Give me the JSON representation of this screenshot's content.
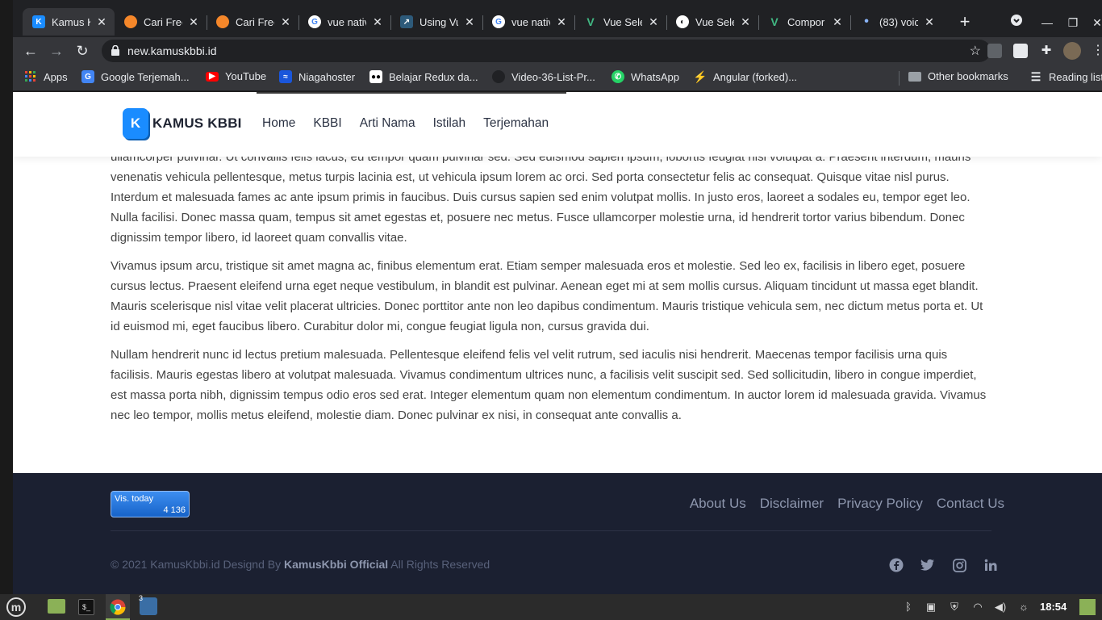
{
  "browser": {
    "tabs": [
      {
        "title": "Kamus K",
        "icon": "kamus-kbbi-favicon",
        "color": "#1a8cff",
        "glyph": "K"
      },
      {
        "title": "Cari Free",
        "icon": "orange-favicon",
        "color": "#f5872a",
        "glyph": ""
      },
      {
        "title": "Cari Free",
        "icon": "orange-favicon",
        "color": "#f5872a",
        "glyph": ""
      },
      {
        "title": "vue nativ",
        "icon": "google-icon",
        "color": "#ffffff",
        "glyph": "G"
      },
      {
        "title": "Using Vu",
        "icon": "chart-favicon",
        "color": "#2d5a7a",
        "glyph": ""
      },
      {
        "title": "vue nativ",
        "icon": "google-icon",
        "color": "#ffffff",
        "glyph": "G"
      },
      {
        "title": "Vue Sele",
        "icon": "vue-icon",
        "color": "#41b883",
        "glyph": "V"
      },
      {
        "title": "Vue Sele",
        "icon": "globe-icon",
        "color": "#ffffff",
        "glyph": ""
      },
      {
        "title": "Compor",
        "icon": "vue-icon",
        "color": "#41b883",
        "glyph": "V"
      },
      {
        "title": "(83) voic",
        "icon": "dot-favicon",
        "color": "#8ab4f8",
        "glyph": "•"
      }
    ],
    "url": "new.kamuskbbi.id",
    "bookmarks": {
      "apps": "Apps",
      "google_translate": "Google Terjemah...",
      "youtube": "YouTube",
      "niagahoster": "Niagahoster",
      "redux": "Belajar Redux da...",
      "video": "Video-36-List-Pr...",
      "whatsapp": "WhatsApp",
      "angular": "Angular (forked)...",
      "other": "Other bookmarks",
      "reading": "Reading list"
    }
  },
  "site": {
    "logo_letter": "K",
    "logo_text": "KAMUS KBBI",
    "nav": [
      "Home",
      "KBBI",
      "Arti Nama",
      "Istilah",
      "Terjemahan"
    ],
    "paragraphs": [
      "ullamcorper pulvinar. Ut convallis felis lacus, eu tempor quam pulvinar sed. Sed euismod sapien ipsum, lobortis feugiat nisi volutpat a. Praesent interdum, mauris venenatis vehicula pellentesque, metus turpis lacinia est, ut vehicula ipsum lorem ac orci. Sed porta consectetur felis ac consequat. Quisque vitae nisl purus. Interdum et malesuada fames ac ante ipsum primis in faucibus. Duis cursus sapien sed enim volutpat mollis. In justo eros, laoreet a sodales eu, tempor eget leo. Nulla facilisi. Donec massa quam, tempus sit amet egestas et, posuere nec metus. Fusce ullamcorper molestie urna, id hendrerit tortor varius bibendum. Donec dignissim tempor libero, id laoreet quam convallis vitae.",
      "Vivamus ipsum arcu, tristique sit amet magna ac, finibus elementum erat. Etiam semper malesuada eros et molestie. Sed leo ex, facilisis in libero eget, posuere cursus lectus. Praesent eleifend urna eget neque vestibulum, in blandit est pulvinar. Aenean eget mi at sem mollis cursus. Aliquam tincidunt ut massa eget blandit. Mauris scelerisque nisl vitae velit placerat ultricies. Donec porttitor ante non leo dapibus condimentum. Mauris tristique vehicula sem, nec dictum metus porta et. Ut id euismod mi, eget faucibus libero. Curabitur dolor mi, congue feugiat ligula non, cursus gravida dui.",
      "Nullam hendrerit nunc id lectus pretium malesuada. Pellentesque eleifend felis vel velit rutrum, sed iaculis nisi hendrerit. Maecenas tempor facilisis urna quis facilisis. Mauris egestas libero at volutpat malesuada. Vivamus condimentum ultrices nunc, a facilisis velit suscipit sed. Sed sollicitudin, libero in congue imperdiet, est massa porta nibh, dignissim tempus odio eros sed erat. Integer elementum quam non elementum condimentum. In auctor lorem id malesuada gravida. Vivamus nec leo tempor, mollis metus eleifend, molestie diam. Donec pulvinar ex nisi, in consequat ante convallis a."
    ],
    "visitor": {
      "label": "Vis. today",
      "value": "4 136"
    },
    "footer_links": [
      "About Us",
      "Disclaimer",
      "Privacy Policy",
      "Contact Us"
    ],
    "copyright_pre": "© 2021 KamusKbbi.id Designd By ",
    "copyright_brand": "KamusKbbi Official",
    "copyright_post": " All Rights Reserved",
    "social": [
      "facebook-icon",
      "twitter-icon",
      "instagram-icon",
      "linkedin-icon"
    ]
  },
  "taskbar": {
    "clock": "18:54",
    "badge": "3"
  }
}
